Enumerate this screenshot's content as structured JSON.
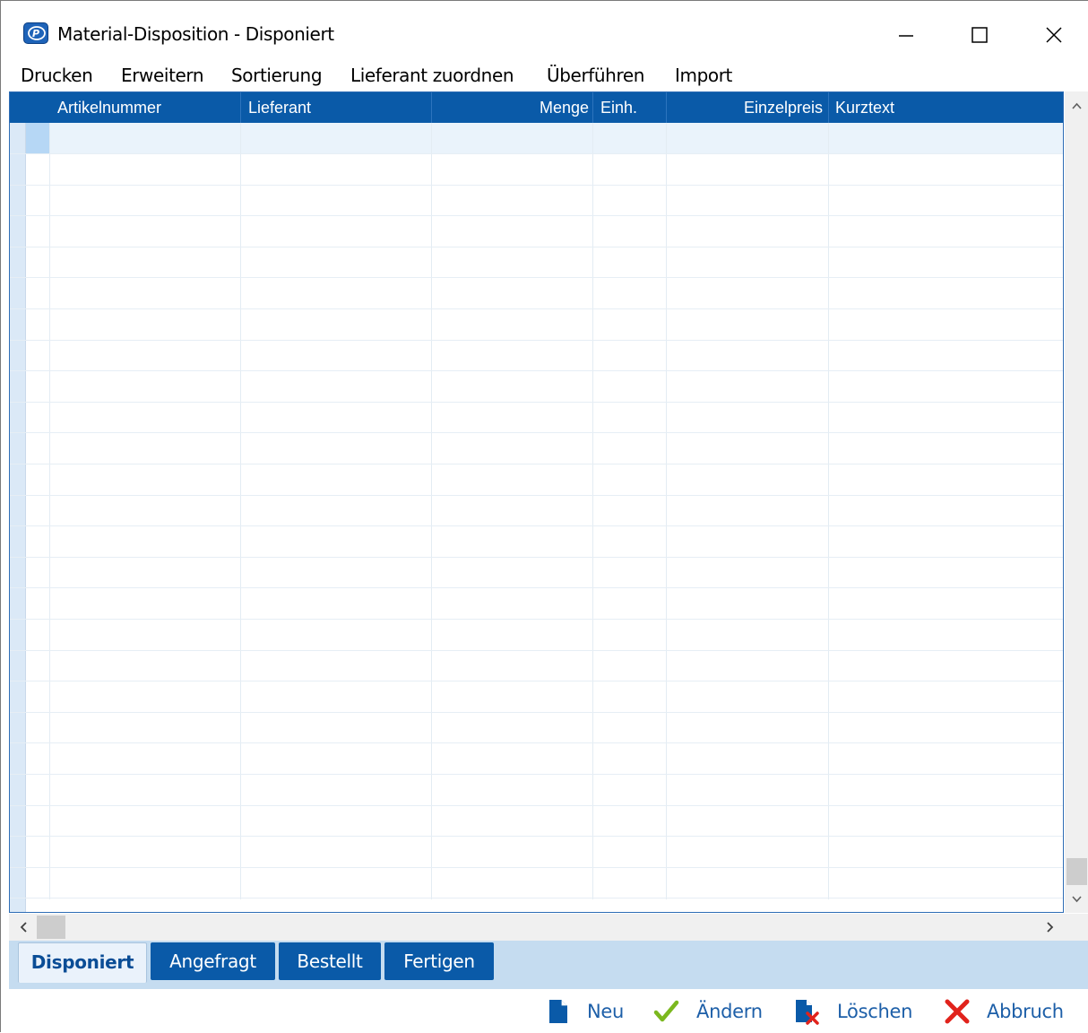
{
  "window": {
    "title": "Material-Disposition - Disponiert",
    "app_icon": "app-logo-icon",
    "controls": [
      "minimize-icon",
      "maximize-icon",
      "close-icon"
    ]
  },
  "menu": {
    "items": [
      {
        "label": "Drucken"
      },
      {
        "label": "Erweitern"
      },
      {
        "label": "Sortierung"
      },
      {
        "label": "Lieferant zuordnen"
      },
      {
        "label": "Überführen"
      },
      {
        "label": "Import"
      }
    ]
  },
  "grid": {
    "columns": [
      {
        "label": "Artikelnummer",
        "align": "left"
      },
      {
        "label": "Lieferant",
        "align": "left"
      },
      {
        "label": "Menge",
        "align": "right"
      },
      {
        "label": "Einh.",
        "align": "left"
      },
      {
        "label": "Einzelpreis",
        "align": "right"
      },
      {
        "label": "Kurztext",
        "align": "left"
      }
    ],
    "rows": []
  },
  "tabs": [
    {
      "label": "Disponiert",
      "active": true
    },
    {
      "label": "Angefragt",
      "active": false
    },
    {
      "label": "Bestellt",
      "active": false
    },
    {
      "label": "Fertigen",
      "active": false
    }
  ],
  "toolbar": {
    "buttons": [
      {
        "label": "Neu",
        "icon": "new-document-icon"
      },
      {
        "label": "Ändern",
        "icon": "checkmark-icon"
      },
      {
        "label": "Löschen",
        "icon": "delete-document-icon"
      },
      {
        "label": "Abbruch",
        "icon": "cancel-icon"
      }
    ]
  },
  "colors": {
    "header_blue": "#0a5aa8",
    "tab_strip": "#c5dcf0",
    "toolbar_text": "#1d5fa8",
    "check_green": "#7bb81e",
    "cancel_red": "#e1231c"
  }
}
